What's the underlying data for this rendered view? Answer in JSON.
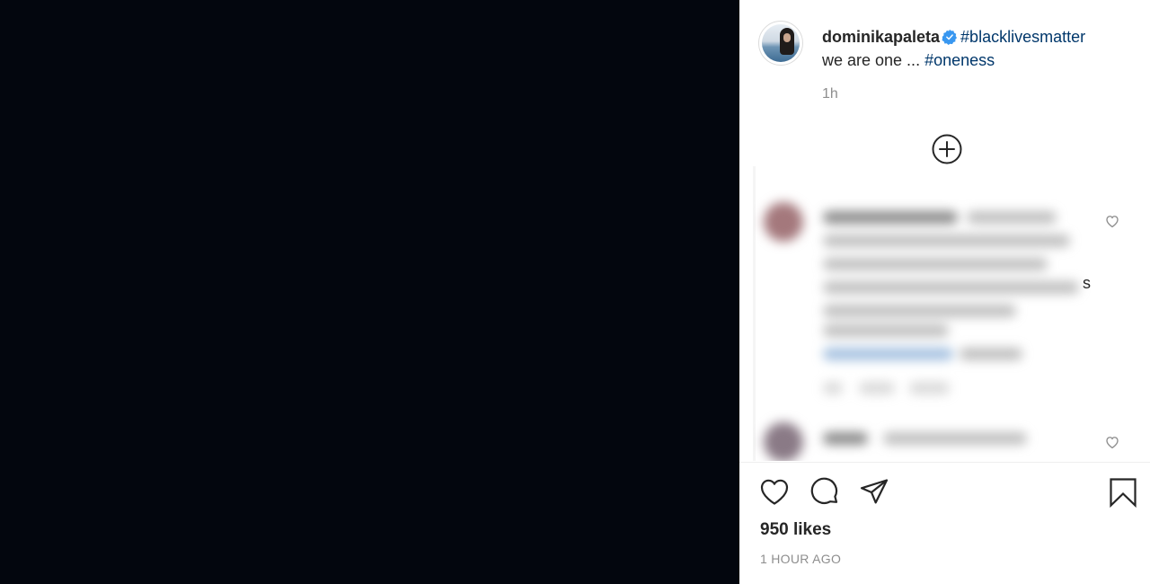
{
  "post": {
    "username": "dominikapaleta",
    "caption_hashtag_1": "#blacklivesmatter",
    "caption_text": "we are one ...",
    "caption_hashtag_2": "#oneness",
    "relative_time": "1h",
    "likes": "950 likes",
    "timestamp": "1 HOUR AGO"
  },
  "comments": {
    "stray_char": "s"
  },
  "icons": {
    "verified": "verified-badge-icon",
    "load_more": "plus-circle-icon",
    "like": "heart-icon",
    "comment": "speech-bubble-icon",
    "share": "paper-plane-icon",
    "save": "bookmark-icon",
    "comment_like": "small-heart-icon"
  },
  "colors": {
    "media_background": "#03060e",
    "hashtag": "#00376b",
    "verified": "#3897f0",
    "muted_text": "#8e8e8e"
  }
}
